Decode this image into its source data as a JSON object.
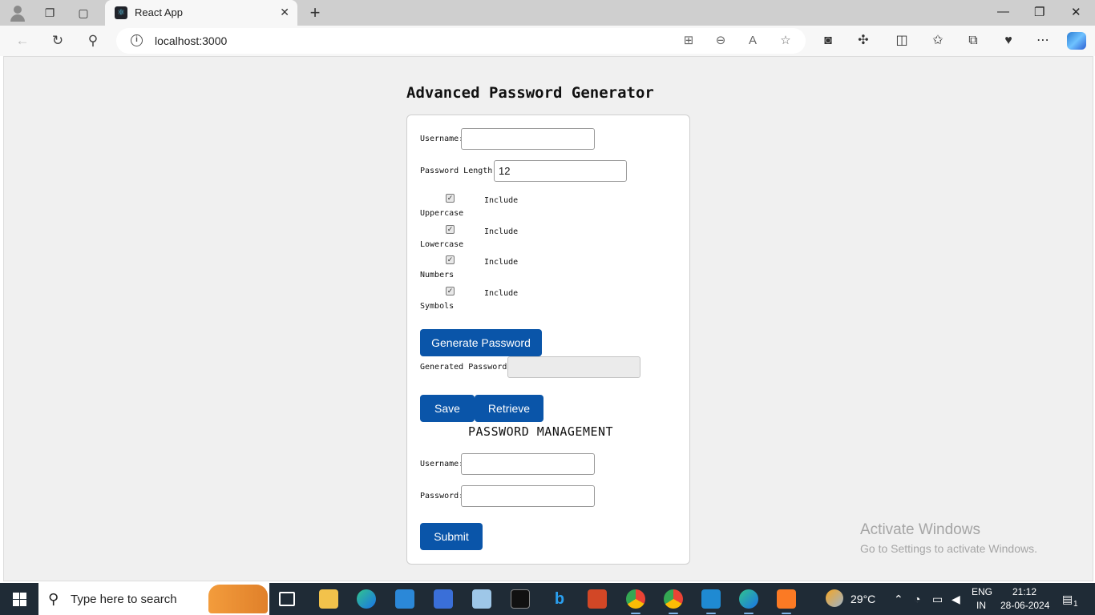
{
  "browser": {
    "tab_title": "React App",
    "url": "localhost:3000"
  },
  "app": {
    "title": "Advanced Password Generator",
    "generator": {
      "username_label": "Username:",
      "username_value": "",
      "length_label": "Password Length:",
      "length_value": "12",
      "options": [
        {
          "word": "Include",
          "label": "Uppercase",
          "checked": true
        },
        {
          "word": "Include",
          "label": "Lowercase",
          "checked": true
        },
        {
          "word": "Include",
          "label": "Numbers",
          "checked": true
        },
        {
          "word": "Include",
          "label": "Symbols",
          "checked": true
        }
      ],
      "generate_button": "Generate Password",
      "generated_label": "Generated Password:",
      "generated_value": "",
      "save_button": "Save",
      "retrieve_button": "Retrieve"
    },
    "management": {
      "heading": "PASSWORD MANAGEMENT",
      "username_label": "Username:",
      "username_value": "",
      "password_label": "Password:",
      "password_value": "",
      "submit_button": "Submit"
    }
  },
  "watermark": {
    "line1": "Activate Windows",
    "line2": "Go to Settings to activate Windows."
  },
  "taskbar": {
    "search_placeholder": "Type here to search",
    "weather": "29°C",
    "language_1": "ENG",
    "language_2": "IN",
    "time": "21:12",
    "date": "28-06-2024",
    "notification_count": "1"
  },
  "colors": {
    "primary_button": "#0a55a9",
    "page_background": "#f0f0f0",
    "taskbar": "#1f2b36"
  }
}
